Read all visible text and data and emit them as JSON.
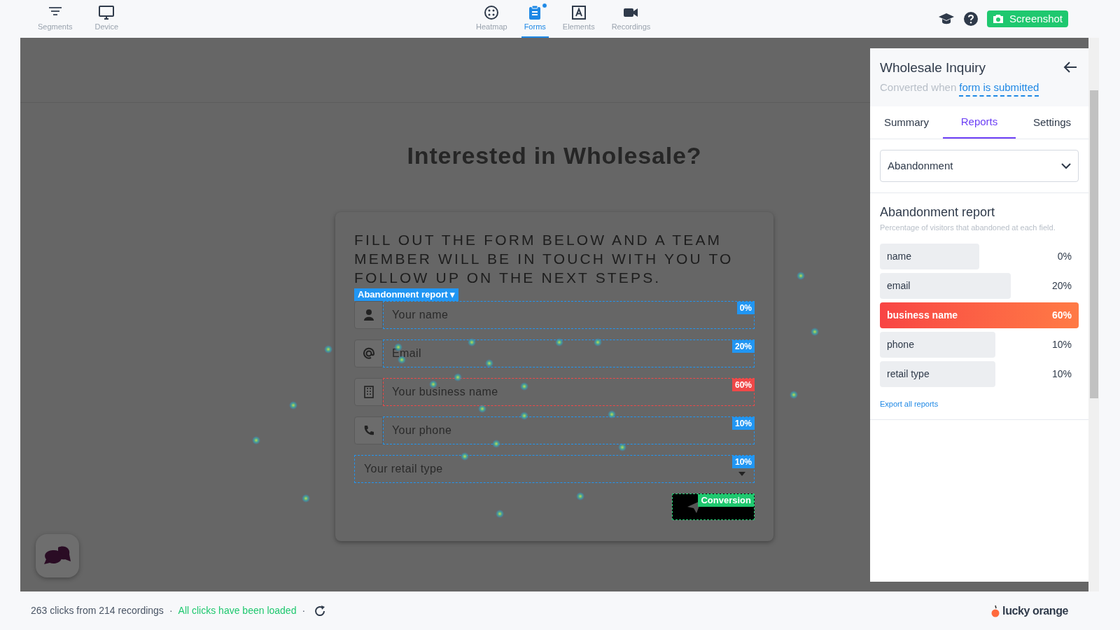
{
  "toolbar": {
    "left": [
      {
        "label": "Segments",
        "kind": "filter"
      },
      {
        "label": "Device",
        "kind": "monitor"
      }
    ],
    "tabs": [
      {
        "label": "Heatmap",
        "kind": "heatmap",
        "selected": false,
        "badge": false
      },
      {
        "label": "Forms",
        "kind": "forms",
        "selected": true,
        "badge": true
      },
      {
        "label": "Elements",
        "kind": "elements",
        "selected": false,
        "badge": false
      },
      {
        "label": "Recordings",
        "kind": "recordings",
        "selected": false,
        "badge": false
      }
    ],
    "screenshot_button": "Screenshot"
  },
  "page": {
    "heading": "Interested in Wholesale?",
    "form": {
      "intro": "FILL OUT THE FORM BELOW AND A TEAM MEMBER WILL BE IN TOUCH WITH YOU TO FOLLOW UP ON THE NEXT STEPS.",
      "report_menu": "Abandonment report ▾",
      "fields": [
        {
          "kind": "person",
          "placeholder": "Your name",
          "rate": "0%",
          "color": "#2196f3"
        },
        {
          "kind": "at",
          "placeholder": "Email",
          "rate": "20%",
          "color": "#2196f3"
        },
        {
          "kind": "building",
          "placeholder": "Your business name",
          "rate": "60%",
          "color": "#f04848"
        },
        {
          "kind": "phone",
          "placeholder": "Your phone",
          "rate": "10%",
          "color": "#2196f3"
        },
        {
          "kind": "select",
          "placeholder": "Your retail type",
          "rate": "10%",
          "color": "#2196f3"
        }
      ],
      "conversion_badge": "Conversion"
    }
  },
  "panel": {
    "title": "Wholesale Inquiry",
    "subtitle": "Converted when",
    "condition_link": "form is submitted",
    "tabs": [
      {
        "label": "Summary",
        "selected": false
      },
      {
        "label": "Reports",
        "selected": true
      },
      {
        "label": "Settings",
        "selected": false
      }
    ],
    "report_select": "Abandonment",
    "report_title": "Abandonment report",
    "report_description": "Percentage of visitors that abandoned at each field.",
    "rows": [
      {
        "label": "name",
        "value": "0%",
        "level": 0.5,
        "highlighted": false
      },
      {
        "label": "email",
        "value": "20%",
        "level": 0.66,
        "highlighted": false
      },
      {
        "label": "business name",
        "value": "60%",
        "level": 1,
        "highlighted": true
      },
      {
        "label": "phone",
        "value": "10%",
        "level": 0.58,
        "highlighted": false
      },
      {
        "label": "retail type",
        "value": "10%",
        "level": 0.58,
        "highlighted": false
      }
    ],
    "export_link": "Export all reports"
  },
  "status_bar": {
    "clicks": "263 clicks from 214 recordings",
    "separators": [
      "·",
      "·"
    ],
    "load_state": "All clicks have been loaded",
    "brand": "lucky orange"
  }
}
